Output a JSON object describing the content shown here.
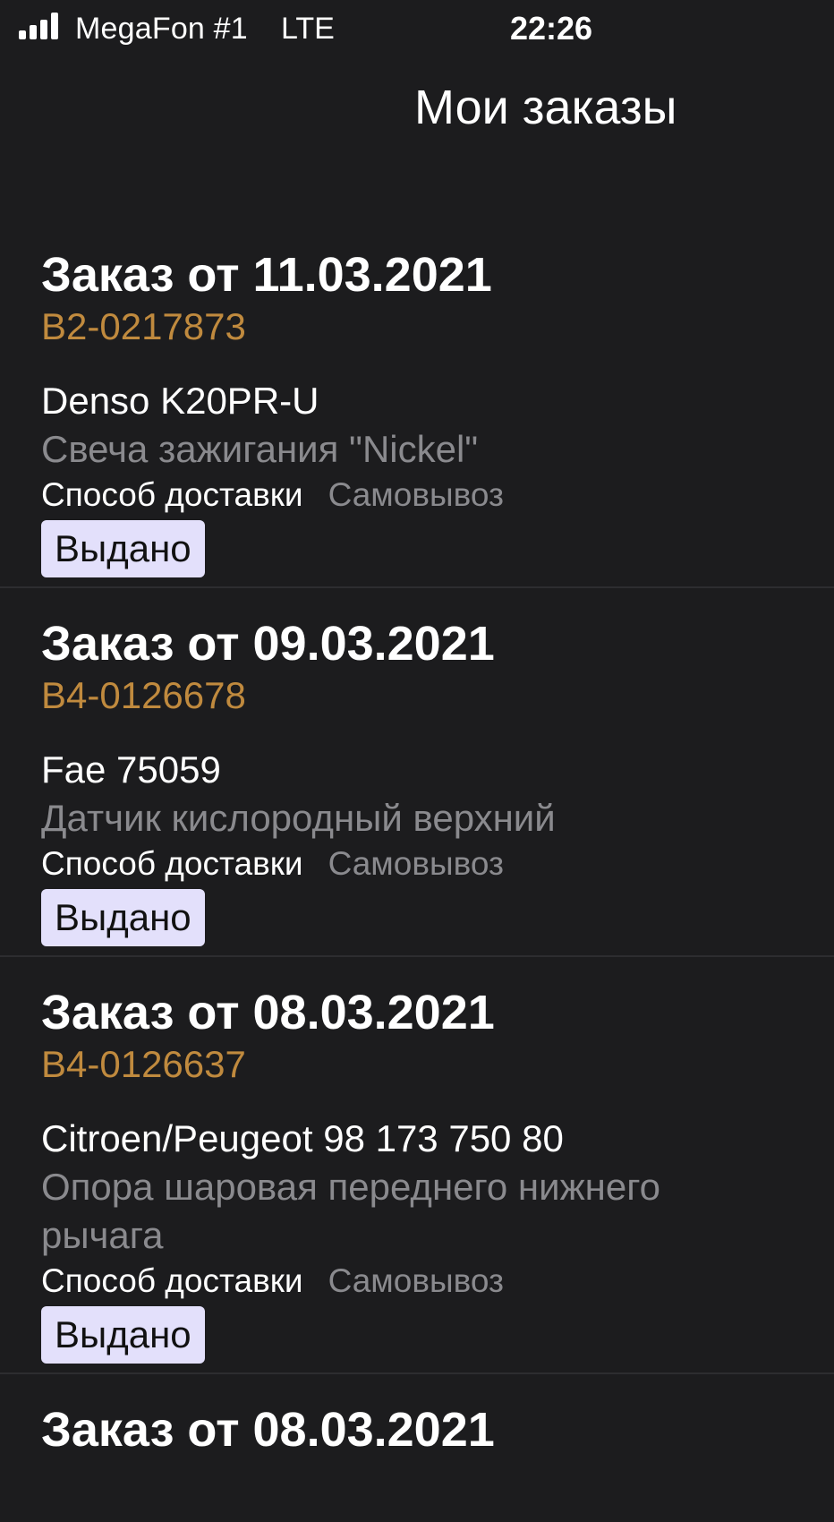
{
  "status_bar": {
    "carrier": "MegaFon #1",
    "network": "LTE",
    "time": "22:26",
    "signal_icon": "signal-bars-icon"
  },
  "header": {
    "title": "Мои заказы"
  },
  "orders": [
    {
      "title": "Заказ от 11.03.2021",
      "number": "B2-0217873",
      "item_name": "Denso K20PR-U",
      "item_desc": "Свеча зажигания \"Nickel\"",
      "delivery_label": "Способ доставки",
      "delivery_value": "Самовывоз",
      "status": "Выдано"
    },
    {
      "title": "Заказ от 09.03.2021",
      "number": "B4-0126678",
      "item_name": "Fae 75059",
      "item_desc": "Датчик кислородный верхний",
      "delivery_label": "Способ доставки",
      "delivery_value": "Самовывоз",
      "status": "Выдано"
    },
    {
      "title": "Заказ от 08.03.2021",
      "number": "B4-0126637",
      "item_name": "Citroen/Peugeot 98 173 750 80",
      "item_desc": "Опора шаровая переднего нижнего рычага",
      "delivery_label": "Способ доставки",
      "delivery_value": "Самовывоз",
      "status": "Выдано"
    },
    {
      "title": "Заказ от 08.03.2021"
    }
  ],
  "colors": {
    "background": "#1c1c1e",
    "order_number": "#c08a3e",
    "secondary_text": "#8a8a8e",
    "badge_bg": "#e3e0fb"
  }
}
